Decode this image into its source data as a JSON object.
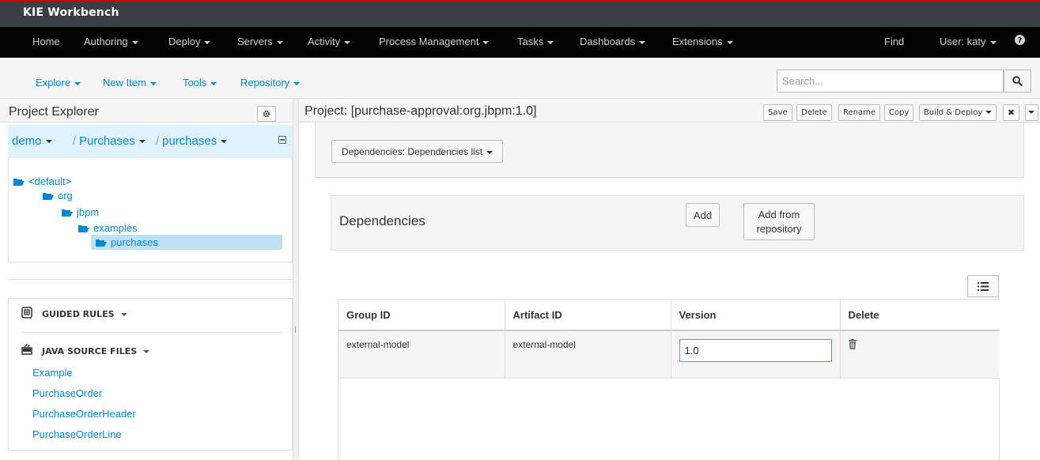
{
  "app": {
    "title": "KIE Workbench"
  },
  "mainnav": {
    "left": [
      {
        "label": "Home",
        "dropdown": false
      },
      {
        "label": "Authoring",
        "dropdown": true
      },
      {
        "label": "Deploy",
        "dropdown": true
      },
      {
        "label": "Servers",
        "dropdown": true
      },
      {
        "label": "Activity",
        "dropdown": true
      },
      {
        "label": "Process Management",
        "dropdown": true
      },
      {
        "label": "Tasks",
        "dropdown": true
      },
      {
        "label": "Dashboards",
        "dropdown": true
      },
      {
        "label": "Extensions",
        "dropdown": true
      }
    ],
    "find": "Find",
    "user": "User: katy",
    "help_icon": "question-circle-icon"
  },
  "subnav": {
    "items": [
      "Explore",
      "New Item",
      "Tools",
      "Repository"
    ],
    "search_placeholder": "Search...",
    "search_icon": "search-icon"
  },
  "explorer": {
    "title": "Project Explorer",
    "gear_icon": "gear-icon",
    "breadcrumb": [
      "demo",
      "Purchases",
      "purchases"
    ],
    "tree": [
      {
        "label": "<default>",
        "depth": 0,
        "selected": false
      },
      {
        "label": "org",
        "depth": 1,
        "selected": false
      },
      {
        "label": "jbpm",
        "depth": 2,
        "selected": false
      },
      {
        "label": "examples",
        "depth": 3,
        "selected": false
      },
      {
        "label": "purchases",
        "depth": 4,
        "selected": true
      }
    ],
    "categories": [
      {
        "label": "GUIDED RULES",
        "icon": "guided-rules-icon",
        "items": []
      },
      {
        "label": "JAVA SOURCE FILES",
        "icon": "java-file-icon",
        "items": [
          "Example",
          "PurchaseOrder",
          "PurchaseOrderHeader",
          "PurchaseOrderLine"
        ]
      }
    ]
  },
  "editor": {
    "title": "Project: [purchase-approval:org.jbpm:1.0]",
    "buttons": [
      "Save",
      "Delete",
      "Rename",
      "Copy",
      "Build & Deploy"
    ],
    "close_icon": "close-icon",
    "section_select": "Dependencies: Dependencies list",
    "dependencies": {
      "title": "Dependencies",
      "add": "Add",
      "add_from_repo_line1": "Add from",
      "add_from_repo_line2": "repository",
      "columns": [
        "Group ID",
        "Artifact ID",
        "Version",
        "Delete"
      ],
      "rows": [
        {
          "group": "external-model",
          "artifact": "external-model",
          "version": "1.0"
        }
      ]
    }
  }
}
